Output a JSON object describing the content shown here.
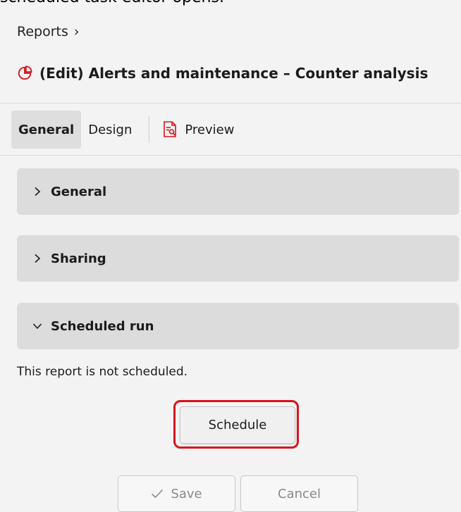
{
  "caption": "scheduled task editor opens.",
  "breadcrumb": {
    "text": "Reports",
    "separator": "›"
  },
  "title": {
    "text": "(Edit) Alerts and maintenance – Counter analysis",
    "icon": "pie-chart-icon",
    "icon_color": "#d7141c"
  },
  "tabs": [
    {
      "label": "General",
      "active": true
    },
    {
      "label": "Design",
      "active": false
    },
    {
      "label": "Preview",
      "icon": "report-preview-icon",
      "active": false
    }
  ],
  "sections": [
    {
      "label": "General",
      "expanded": false
    },
    {
      "label": "Sharing",
      "expanded": false
    },
    {
      "label": "Scheduled run",
      "expanded": true
    }
  ],
  "scheduled": {
    "status_text": "This report is not scheduled.",
    "schedule_button": "Schedule"
  },
  "footer": {
    "save_label": "Save",
    "cancel_label": "Cancel"
  },
  "colors": {
    "accent_red": "#d7141c",
    "section_bg": "#dcdcdc",
    "page_bg": "#f3f3f3"
  }
}
